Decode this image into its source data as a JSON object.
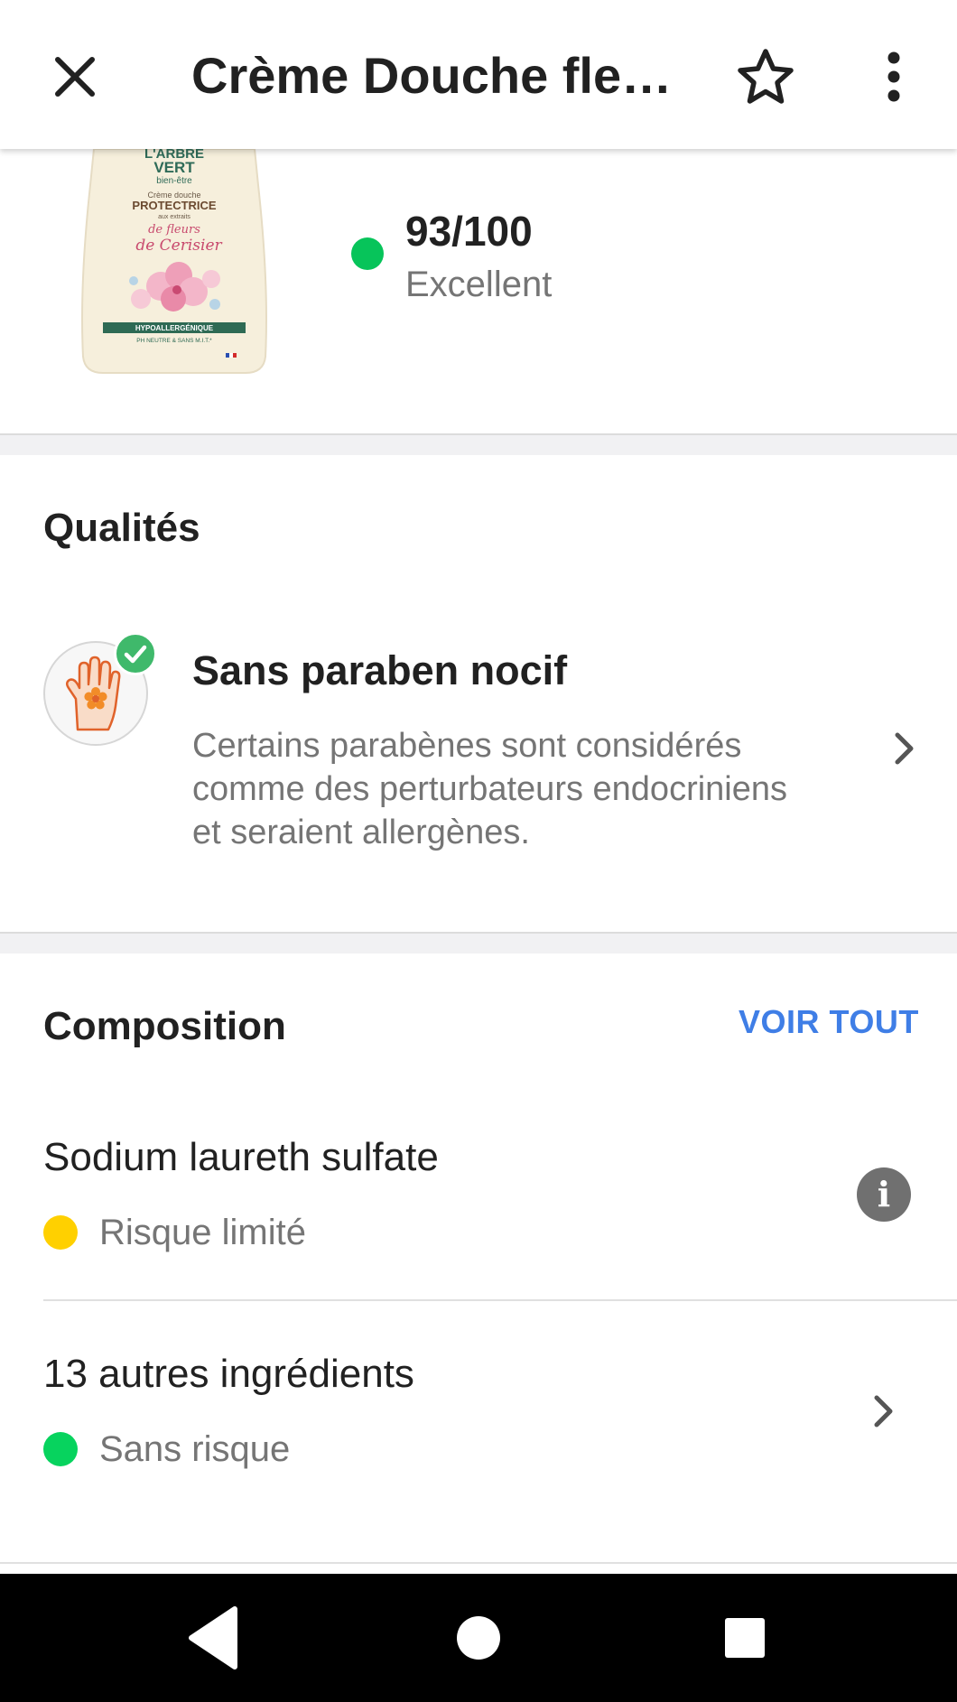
{
  "topbar": {
    "title": "Crème Douche fleurs de Cerisier",
    "close_icon": "close-icon",
    "favorite_icon": "star-outline-icon",
    "more_icon": "more-vertical-icon"
  },
  "product": {
    "bottle": {
      "brand_line1": "L'ARBRE",
      "brand_line2": "VERT",
      "brand_line3": "bien-être",
      "subtitle": "Crème douche",
      "claim": "PROTECTRICE",
      "claim_sub": "aux extraits",
      "scent1": "de fleurs",
      "scent2": "de Cerisier",
      "banner": "HYPOALLERGÉNIQUE",
      "small": "PH NEUTRE & SANS M.I.T.*"
    },
    "score": "93/100",
    "score_label": "Excellent",
    "score_color": "#07c45a"
  },
  "qualities": {
    "title": "Qualités",
    "items": [
      {
        "title": "Sans paraben nocif",
        "description": "Certains parabènes sont considérés comme des perturbateurs endocriniens et seraient allergènes.",
        "icon": "hand-flower-icon",
        "badge_icon": "check-icon"
      }
    ]
  },
  "composition": {
    "title": "Composition",
    "see_all": "VOIR TOUT",
    "ingredients": [
      {
        "name": "Sodium laureth sulfate",
        "risk": "Risque limité",
        "risk_color": "#ffd000",
        "action_icon": "info-icon"
      },
      {
        "name": "13 autres ingrédients",
        "risk": "Sans risque",
        "risk_color": "#07d35e",
        "action_icon": "chevron-right-icon"
      }
    ]
  },
  "navbar": {
    "back_icon": "triangle-back-icon",
    "home_icon": "circle-home-icon",
    "recents_icon": "square-recents-icon"
  },
  "colors": {
    "accent": "#3f7ee6",
    "excellent": "#07c45a",
    "limited_risk": "#ffd000",
    "no_risk": "#07d35e"
  }
}
